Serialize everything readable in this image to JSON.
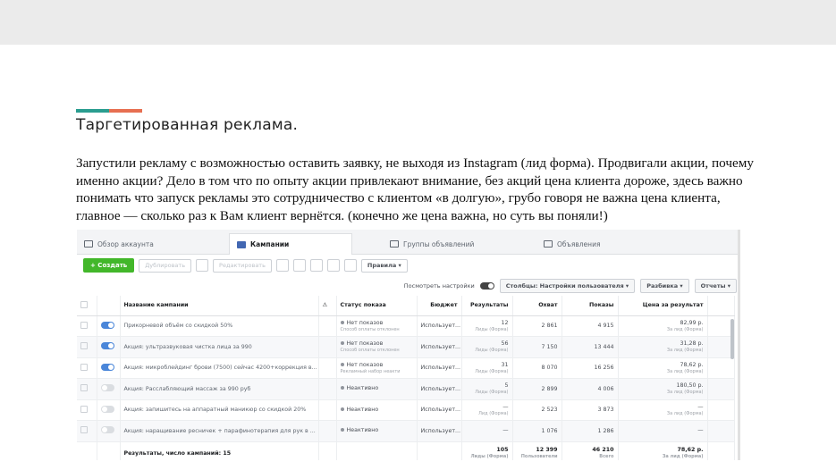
{
  "slide": {
    "title": "Таргетированная реклама.",
    "body": "Запустили рекламу с возможностью оставить заявку, не выходя из Instagram (лид форма). Продвигали акции, почему именно акции? Дело в том что по опыту акции привлекают внимание, без акций цена клиента дороже, здесь важно понимать что запуск рекламы это сотрудничество с клиентом «в долгую», грубо говоря не важна цена клиента, главное — сколько раз к Вам клиент вернётся. (конечно же цена важна, но суть вы поняли!)",
    "accent_colors": [
      "#2a9d8f",
      "#e76f51"
    ]
  },
  "ads_manager": {
    "tabs": [
      "Обзор аккаунта",
      "Кампании",
      "Группы объявлений",
      "Объявления"
    ],
    "toolbar": {
      "create": "+ Создать",
      "duplicate": "Дублировать",
      "edit": "Редактировать",
      "rules": "Правила ▾"
    },
    "viewbar": {
      "view_settings": "Посмотреть настройки",
      "columns": "Столбцы: Настройки пользователя ▾",
      "breakdown": "Разбивка ▾",
      "reports": "Отчеты ▾"
    },
    "headers": {
      "name": "Название кампании",
      "status": "Статус показа",
      "budget": "Бюджет",
      "results": "Результаты",
      "reach": "Охват",
      "impressions": "Показы",
      "cost": "Цена за результат"
    },
    "rows": [
      {
        "on": true,
        "name": "Прикорневой объём со скидкой 50%",
        "status": "Нет показов",
        "status_sub": "Способ оплаты отклонен",
        "budget": "Использует...",
        "results": "12",
        "results_sub": "Лиды (Форма)",
        "reach": "2 861",
        "impressions": "4 915",
        "cost": "82,99 р.",
        "cost_sub": "За лид (Форма)"
      },
      {
        "on": true,
        "name": "Акция: ультразвуковая чистка лица за 990",
        "status": "Нет показов",
        "status_sub": "Способ оплаты отклонен",
        "budget": "Использует...",
        "results": "56",
        "results_sub": "Лиды (Форма)",
        "reach": "7 150",
        "impressions": "13 444",
        "cost": "31,28 р.",
        "cost_sub": "За лид (Форма)"
      },
      {
        "on": true,
        "name": "Акция: микроблейдинг брови (7500) сейчас 4200+коррекция в...",
        "status": "Нет показов",
        "status_sub": "Рекламный набор неакти",
        "budget": "Использует...",
        "results": "31",
        "results_sub": "Лиды (Форма)",
        "reach": "8 070",
        "impressions": "16 256",
        "cost": "78,62 р.",
        "cost_sub": "За лид (Форма)"
      },
      {
        "on": false,
        "name": "Акция: Расслабляющий массаж за 990 руб",
        "status": "Неактивно",
        "status_sub": "",
        "budget": "Использует...",
        "results": "5",
        "results_sub": "Лиды (Форма)",
        "reach": "2 899",
        "impressions": "4 006",
        "cost": "180,50 р.",
        "cost_sub": "За лид (Форма)"
      },
      {
        "on": false,
        "name": "Акция: запишитесь на аппаратный маникюр со скидкой 20%",
        "status": "Неактивно",
        "status_sub": "",
        "budget": "Использует...",
        "results": "—",
        "results_sub": "Лид (Форма)",
        "reach": "2 523",
        "impressions": "3 873",
        "cost": "—",
        "cost_sub": "За лид (Форма)"
      },
      {
        "on": false,
        "name": "Акция: наращивание ресничек + парафинотерапия для рук в ...",
        "status": "Неактивно",
        "status_sub": "",
        "budget": "Использует...",
        "results": "—",
        "results_sub": "",
        "reach": "1 076",
        "impressions": "1 286",
        "cost": "—",
        "cost_sub": ""
      }
    ],
    "total": {
      "label": "Результаты, число кампаний: 15",
      "results": "105",
      "results_sub": "Лиды (Форма)",
      "reach": "12 399",
      "reach_sub": "Пользователи",
      "impressions": "46 210",
      "impressions_sub": "Всего",
      "cost": "78,62 р.",
      "cost_sub": "За лид (Форма)"
    }
  }
}
